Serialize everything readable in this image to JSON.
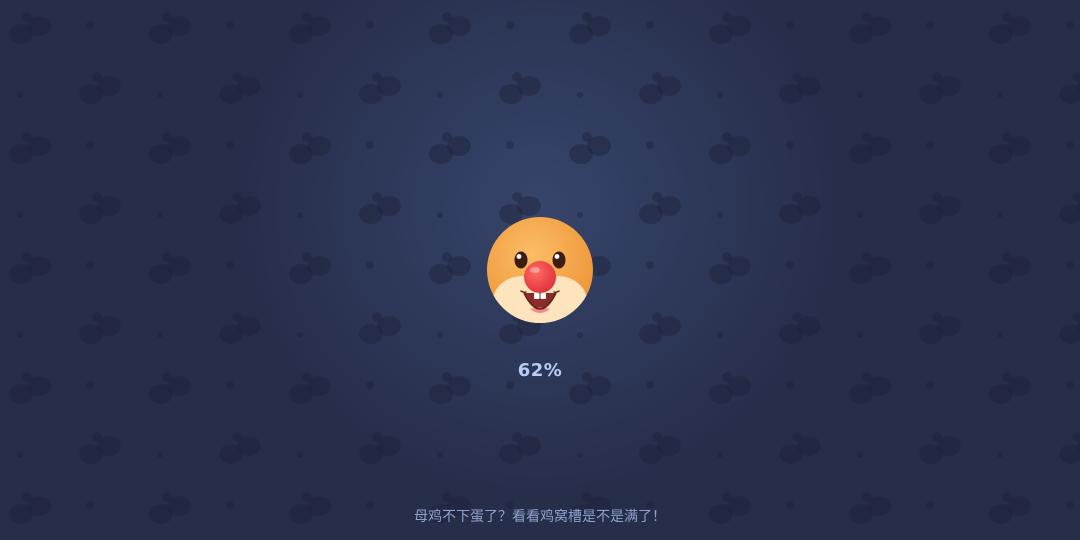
{
  "loading": {
    "percent_text": "62%",
    "progress": 0.62,
    "tip": "母鸡不下蛋了？看看鸡窝槽是不是满了！"
  },
  "icons": {
    "mascot": "hamster-clown-face-icon",
    "background": "clover-leaf-pattern"
  },
  "colors": {
    "background": "#262c46",
    "glow": "#37456a",
    "percent_text": "#b9cdf5",
    "tip_text": "#8fa2cc",
    "mascot_fur": "#f5a94e",
    "mascot_nose": "#ef4245"
  }
}
